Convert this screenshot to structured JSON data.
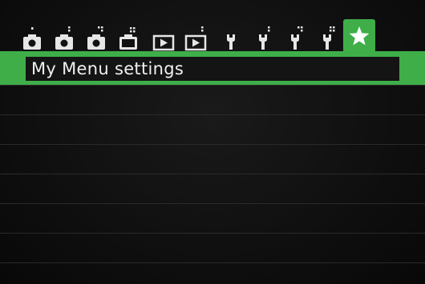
{
  "tabs": [
    {
      "icon": "camera-icon-1"
    },
    {
      "icon": "camera-icon-2"
    },
    {
      "icon": "camera-icon-3"
    },
    {
      "icon": "camera-icon-4"
    },
    {
      "icon": "playback-icon-1"
    },
    {
      "icon": "playback-icon-2"
    },
    {
      "icon": "wrench-icon-1"
    },
    {
      "icon": "wrench-icon-2"
    },
    {
      "icon": "wrench-icon-3"
    },
    {
      "icon": "wrench-icon-4"
    },
    {
      "icon": "star-icon",
      "active": true
    }
  ],
  "menu": {
    "items": [
      {
        "label": "My Menu settings",
        "selected": true
      }
    ]
  },
  "colors": {
    "accent": "#3fae49",
    "background": "#101010",
    "text": "#f0f0f0"
  }
}
